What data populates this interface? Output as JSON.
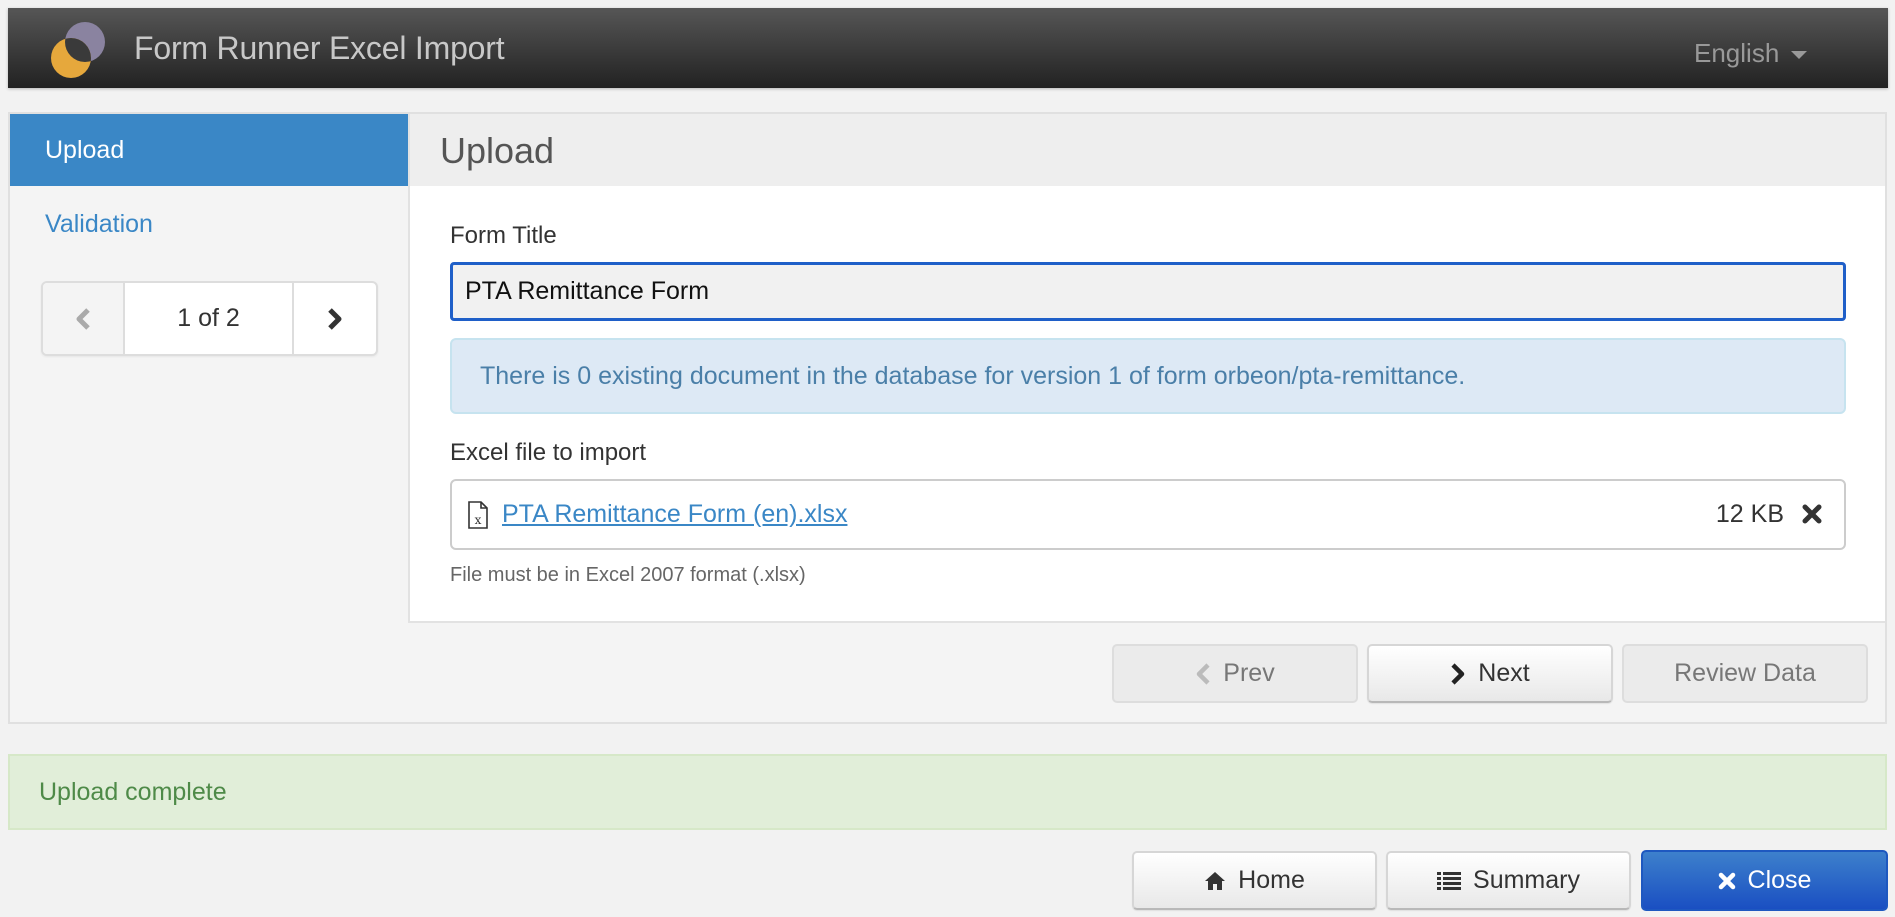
{
  "navbar": {
    "app_title": "Form Runner Excel Import",
    "language": "English",
    "logo_colors": {
      "top": "#8a83a0",
      "bottom": "#e6a83c"
    }
  },
  "sidebar": {
    "items": [
      {
        "label": "Upload",
        "active": true
      },
      {
        "label": "Validation",
        "active": false
      }
    ],
    "pager": {
      "text": "1 of 2",
      "current": 1,
      "total": 2
    }
  },
  "main": {
    "section_title": "Upload",
    "form_title_label": "Form Title",
    "form_title_value": "PTA Remittance Form",
    "info_message": "There is 0 existing document in the database for version 1 of form orbeon/pta-remittance.",
    "excel_label": "Excel file to import",
    "file": {
      "name": "PTA Remittance Form (en).xlsx",
      "size": "12 KB"
    },
    "help_text": "File must be in Excel 2007 format (.xlsx)"
  },
  "wizard_buttons": {
    "prev": "Prev",
    "next": "Next",
    "review": "Review Data"
  },
  "status": {
    "message": "Upload complete"
  },
  "bottom_buttons": {
    "home": "Home",
    "summary": "Summary",
    "close": "Close"
  },
  "colors": {
    "accent": "#3a87c6",
    "primary_button": "#1f5fc8",
    "info_bg": "#dde9f5",
    "success_bg": "#e1eed9"
  }
}
